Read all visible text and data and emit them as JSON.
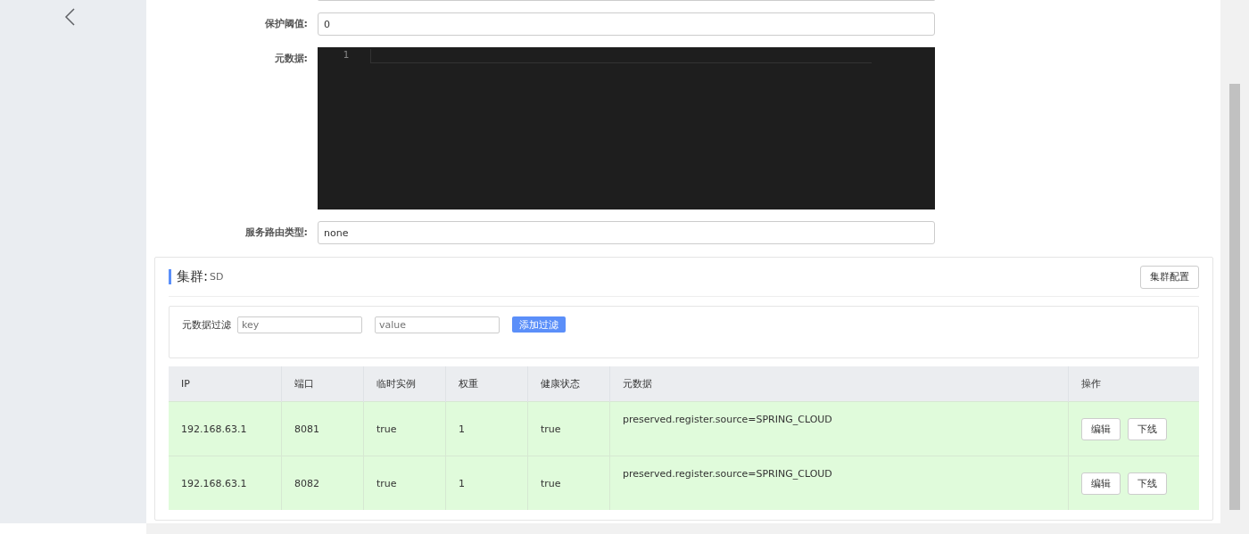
{
  "form": [
    {
      "label": "保护阈值:",
      "kind": "input",
      "value": "0"
    },
    {
      "label": "元数据:",
      "kind": "editor",
      "line_numbers": [
        "1"
      ]
    },
    {
      "label": "服务路由类型:",
      "kind": "input",
      "value": "none"
    }
  ],
  "cluster": {
    "title": "集群:",
    "name": "SD",
    "config_button": "集群配置",
    "filter": {
      "label": "元数据过滤",
      "key_placeholder": "key",
      "value_placeholder": "value",
      "add_button": "添加过滤"
    },
    "table": {
      "columns": [
        "IP",
        "端口",
        "临时实例",
        "权重",
        "健康状态",
        "元数据",
        "操作"
      ],
      "rows": [
        {
          "cells": [
            "192.168.63.1",
            "8081",
            "true",
            "1",
            "true",
            "preserved.register.source=SPRING_CLOUD"
          ],
          "actions": [
            "编辑",
            "下线"
          ]
        },
        {
          "cells": [
            "192.168.63.1",
            "8082",
            "true",
            "1",
            "true",
            "preserved.register.source=SPRING_CLOUD"
          ],
          "actions": [
            "编辑",
            "下线"
          ]
        }
      ]
    }
  }
}
